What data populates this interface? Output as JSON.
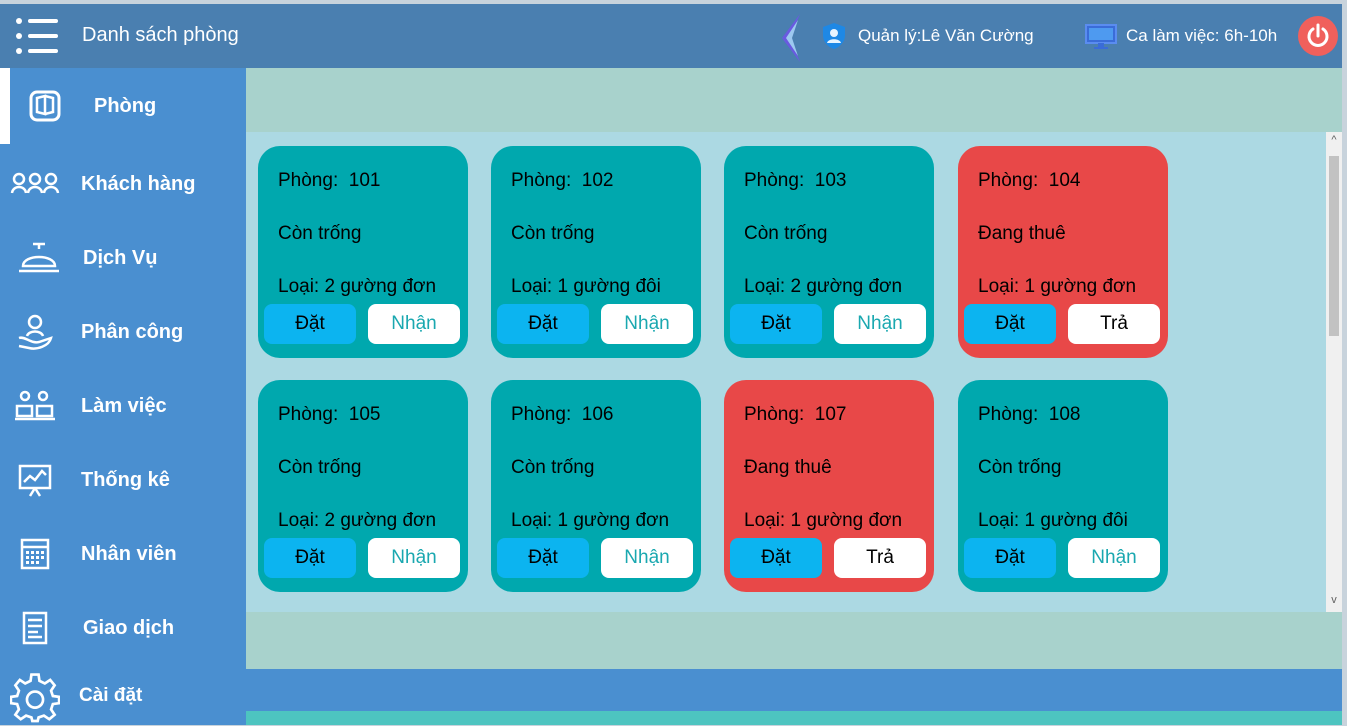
{
  "header": {
    "title": "Danh sách phòng",
    "manager": "Quản lý:Lê Văn Cường",
    "shift": "Ca làm việc: 6h-10h"
  },
  "sidebar": {
    "items": [
      {
        "label": "Phòng",
        "icon": "room-icon"
      },
      {
        "label": "Khách hàng",
        "icon": "customers-icon"
      },
      {
        "label": "Dịch Vụ",
        "icon": "service-bell-icon"
      },
      {
        "label": "Phân công",
        "icon": "assignment-icon"
      },
      {
        "label": "Làm việc",
        "icon": "work-icon"
      },
      {
        "label": "Thống kê",
        "icon": "statistics-icon"
      },
      {
        "label": "Nhân viên",
        "icon": "calendar-icon"
      },
      {
        "label": "Giao dịch",
        "icon": "document-icon"
      },
      {
        "label": "Cài đặt",
        "icon": "gear-icon"
      }
    ]
  },
  "rooms": [
    {
      "label": "Phòng:",
      "number": "101",
      "status": "Còn trống",
      "type": "Loại: 2 gường đơn",
      "book": "Đặt",
      "action": "Nhận"
    },
    {
      "label": "Phòng:",
      "number": "102",
      "status": "Còn trống",
      "type": "Loại: 1 gường đôi",
      "book": "Đặt",
      "action": "Nhận"
    },
    {
      "label": "Phòng:",
      "number": "103",
      "status": "Còn trống",
      "type": "Loại: 2 gường đơn",
      "book": "Đặt",
      "action": "Nhận"
    },
    {
      "label": "Phòng:",
      "number": "104",
      "status": "Đang thuê",
      "type": "Loại: 1 gường đơn",
      "book": "Đặt",
      "action": "Trả"
    },
    {
      "label": "Phòng:",
      "number": "105",
      "status": "Còn trống",
      "type": "Loại: 2 gường đơn",
      "book": "Đặt",
      "action": "Nhận"
    },
    {
      "label": "Phòng:",
      "number": "106",
      "status": "Còn trống",
      "type": "Loại: 1 gường đơn",
      "book": "Đặt",
      "action": "Nhận"
    },
    {
      "label": "Phòng:",
      "number": "107",
      "status": "Đang thuê",
      "type": "Loại: 1 gường đơn",
      "book": "Đặt",
      "action": "Trả"
    },
    {
      "label": "Phòng:",
      "number": "108",
      "status": "Còn trống",
      "type": "Loại: 1 gường đôi",
      "book": "Đặt",
      "action": "Nhận"
    }
  ],
  "colors": {
    "topbar": "#4a7fb0",
    "sidebar": "#4a8fd0",
    "vacant": "#00a8ae",
    "rented": "#e84848",
    "book_button": "#0cb4f0",
    "power": "#f0605c"
  }
}
